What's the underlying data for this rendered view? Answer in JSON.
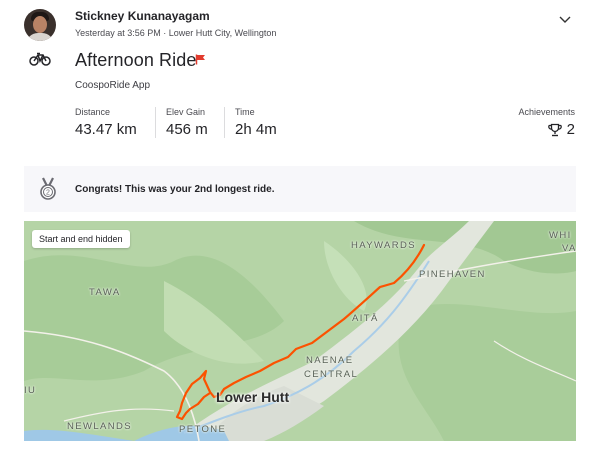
{
  "athlete": {
    "name": "Stickney Kunanayagam",
    "meta": "Yesterday at 3:56 PM · Lower Hutt City, Wellington"
  },
  "activity": {
    "title": "Afternoon Ride",
    "device": "CoospoRide App",
    "type_icon": "bike-icon",
    "flag_icon": "flag-icon"
  },
  "stats": [
    {
      "label": "Distance",
      "value": "43.47 km"
    },
    {
      "label": "Elev Gain",
      "value": "456 m"
    },
    {
      "label": "Time",
      "value": "2h 4m"
    }
  ],
  "achievements": {
    "label": "Achievements",
    "value": "2",
    "icon": "trophy-icon"
  },
  "congrats": {
    "text": "Congrats! This was your 2nd longest ride.",
    "icon": "medal-icon"
  },
  "map": {
    "chip": "Start and end hidden",
    "places": {
      "haywards": "HAYWARDS",
      "whi": "WHI",
      "va": "VA",
      "pinehaven": "PINEHAVEN",
      "tawa": "TAWA",
      "taita": "AITĀ",
      "naenae1": "NAENAE",
      "naenae2": "CENTRAL",
      "iu": "IU",
      "newlands": "NEWLANDS",
      "petone": "PETONE",
      "lower_hutt": "Lower Hutt"
    },
    "route_color": "#fc5200"
  },
  "colors": {
    "accent": "#fc5200",
    "map_green": "#b9d7ab"
  }
}
